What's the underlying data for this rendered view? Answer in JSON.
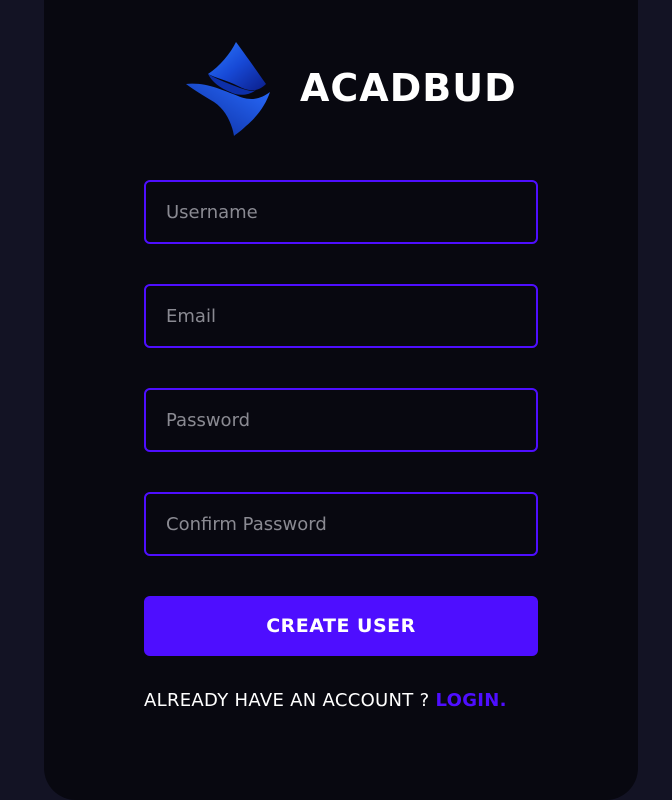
{
  "brand": {
    "name": "ACADBUD",
    "logo_icon": "acadbud-logo-icon"
  },
  "form": {
    "username_placeholder": "Username",
    "email_placeholder": "Email",
    "password_placeholder": "Password",
    "confirm_password_placeholder": "Confirm Password",
    "submit_label": "CREATE USER"
  },
  "footer": {
    "prompt": "ALREADY HAVE AN ACCOUNT ?",
    "link_label": "LOGIN."
  },
  "colors": {
    "page_background": "#131324",
    "card_background": "#080810",
    "accent": "#4e0eff",
    "text": "#ffffff",
    "placeholder": "#8a8a92"
  }
}
